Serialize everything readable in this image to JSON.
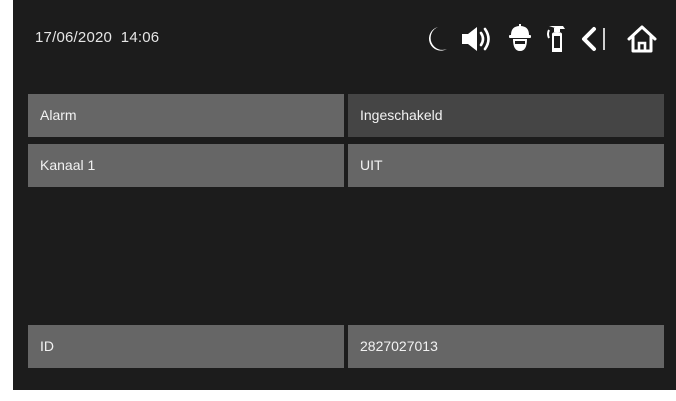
{
  "header": {
    "datetime": "17/06/2020  14:06",
    "icons": [
      "moon-icon",
      "speaker-icon",
      "guard-icon",
      "extinguisher-icon",
      "back-icon",
      "home-icon"
    ]
  },
  "rows": [
    {
      "label": "Alarm",
      "value": "Ingeschakeld",
      "highlighted": true
    },
    {
      "label": "Kanaal 1",
      "value": "UIT",
      "highlighted": false
    },
    {
      "label": "ID",
      "value": "2827027013",
      "highlighted": false
    }
  ],
  "colors": {
    "background": "#1c1c1c",
    "cell": "#666666",
    "cell_highlight": "#454545",
    "text": "#f2f2f2",
    "icon": "#ffffff"
  }
}
